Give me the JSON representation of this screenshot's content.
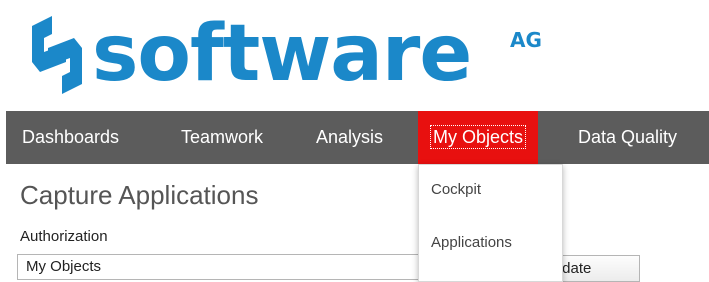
{
  "logo": {
    "wordmark": "software",
    "superscript": "AG",
    "color": "#1b88c9"
  },
  "nav": {
    "items": [
      {
        "label": "Dashboards"
      },
      {
        "label": "Teamwork"
      },
      {
        "label": "Analysis"
      },
      {
        "label": "My Objects",
        "active": true
      },
      {
        "label": "Data Quality"
      }
    ],
    "background": "#5c5c5c",
    "active_color": "#e8100f"
  },
  "page": {
    "title": "Capture Applications",
    "authorization_label": "Authorization",
    "authorization_value": "My Objects",
    "update_button_label": "Update"
  },
  "dropdown": {
    "items": [
      {
        "label": "Cockpit"
      },
      {
        "label": "Applications"
      }
    ]
  }
}
